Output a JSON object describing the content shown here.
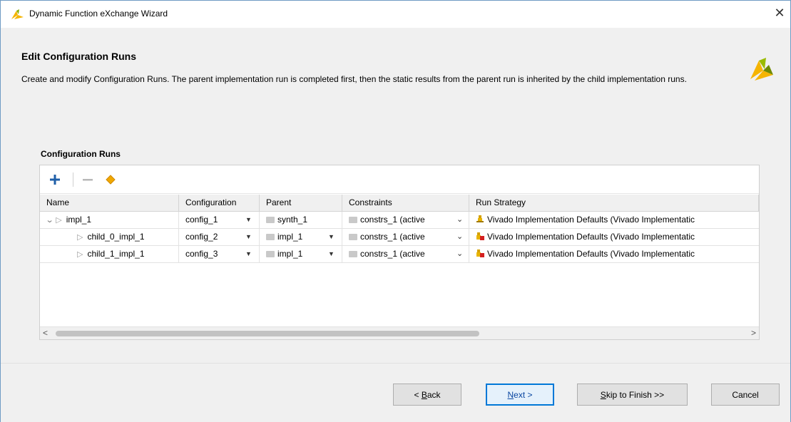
{
  "window": {
    "title": "Dynamic Function eXchange Wizard"
  },
  "header": {
    "title": "Edit Configuration Runs",
    "description": "Create and modify Configuration Runs. The parent implementation run is completed first, then the static results from the parent run is inherited by the child implementation runs."
  },
  "section": {
    "label": "Configuration Runs"
  },
  "toolbar": {
    "add_icon": "plus-icon",
    "remove_icon": "minus-icon",
    "edit_icon": "diamond-icon"
  },
  "table": {
    "columns": [
      "Name",
      "Configuration",
      "Parent",
      "Constraints",
      "Run Strategy"
    ],
    "rows": [
      {
        "name": "impl_1",
        "configuration": "config_1",
        "parent": "synth_1",
        "constraints": "constrs_1 (active",
        "strategy": "Vivado Implementation Defaults (Vivado Implementatic"
      },
      {
        "name": "child_0_impl_1",
        "configuration": "config_2",
        "parent": "impl_1",
        "constraints": "constrs_1 (active",
        "strategy": "Vivado Implementation Defaults (Vivado Implementatic"
      },
      {
        "name": "child_1_impl_1",
        "configuration": "config_3",
        "parent": "impl_1",
        "constraints": "constrs_1 (active",
        "strategy": "Vivado Implementation Defaults (Vivado Implementatic"
      }
    ]
  },
  "buttons": {
    "back": {
      "prefix": "< ",
      "mnemonic": "B",
      "rest": "ack"
    },
    "next": {
      "mnemonic": "N",
      "rest": "ext >"
    },
    "skip": {
      "mnemonic": "S",
      "rest": "kip to Finish >>"
    },
    "cancel": "Cancel"
  },
  "colors": {
    "accent": "#0078d7",
    "logo_yellow": "#f5b400",
    "logo_green": "#6e8a00",
    "add_icon": "#2a6ebb",
    "edit_icon": "#e8a000"
  }
}
